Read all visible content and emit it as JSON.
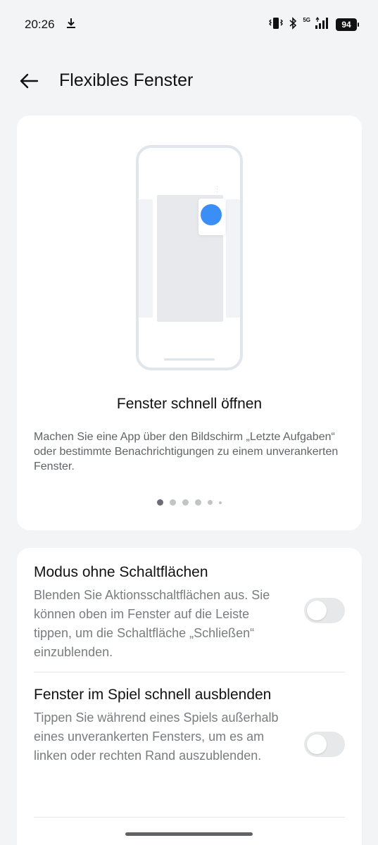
{
  "status_bar": {
    "time": "20:26",
    "network": "5G",
    "battery": "94",
    "icons": [
      "download-icon",
      "vibrate-icon",
      "bluetooth-icon",
      "signal-icon",
      "battery-icon"
    ]
  },
  "header": {
    "title": "Flexibles Fenster",
    "back_icon": "arrow-left-icon"
  },
  "intro_card": {
    "slide_title": "Fenster schnell öffnen",
    "slide_description": "Machen Sie eine App über den Bildschirm „Letzte Aufgaben“ oder bestimmte Benachrichtigungen zu einem unverankerten Fenster.",
    "page_count": 6,
    "active_page": 1,
    "colors": {
      "accent": "#3a8ef6"
    }
  },
  "settings": [
    {
      "title": "Modus ohne Schaltflächen",
      "description": "Blenden Sie Aktionsschaltflächen aus. Sie können oben im Fenster auf die Leiste tippen, um die Schaltfläche „Schließen“ einzublenden.",
      "enabled": false
    },
    {
      "title": "Fenster im Spiel schnell ausblenden",
      "description": "Tippen Sie während eines Spiels außerhalb eines unverankerten Fensters, um es am linken oder rechten Rand auszublenden.",
      "enabled": false
    }
  ]
}
